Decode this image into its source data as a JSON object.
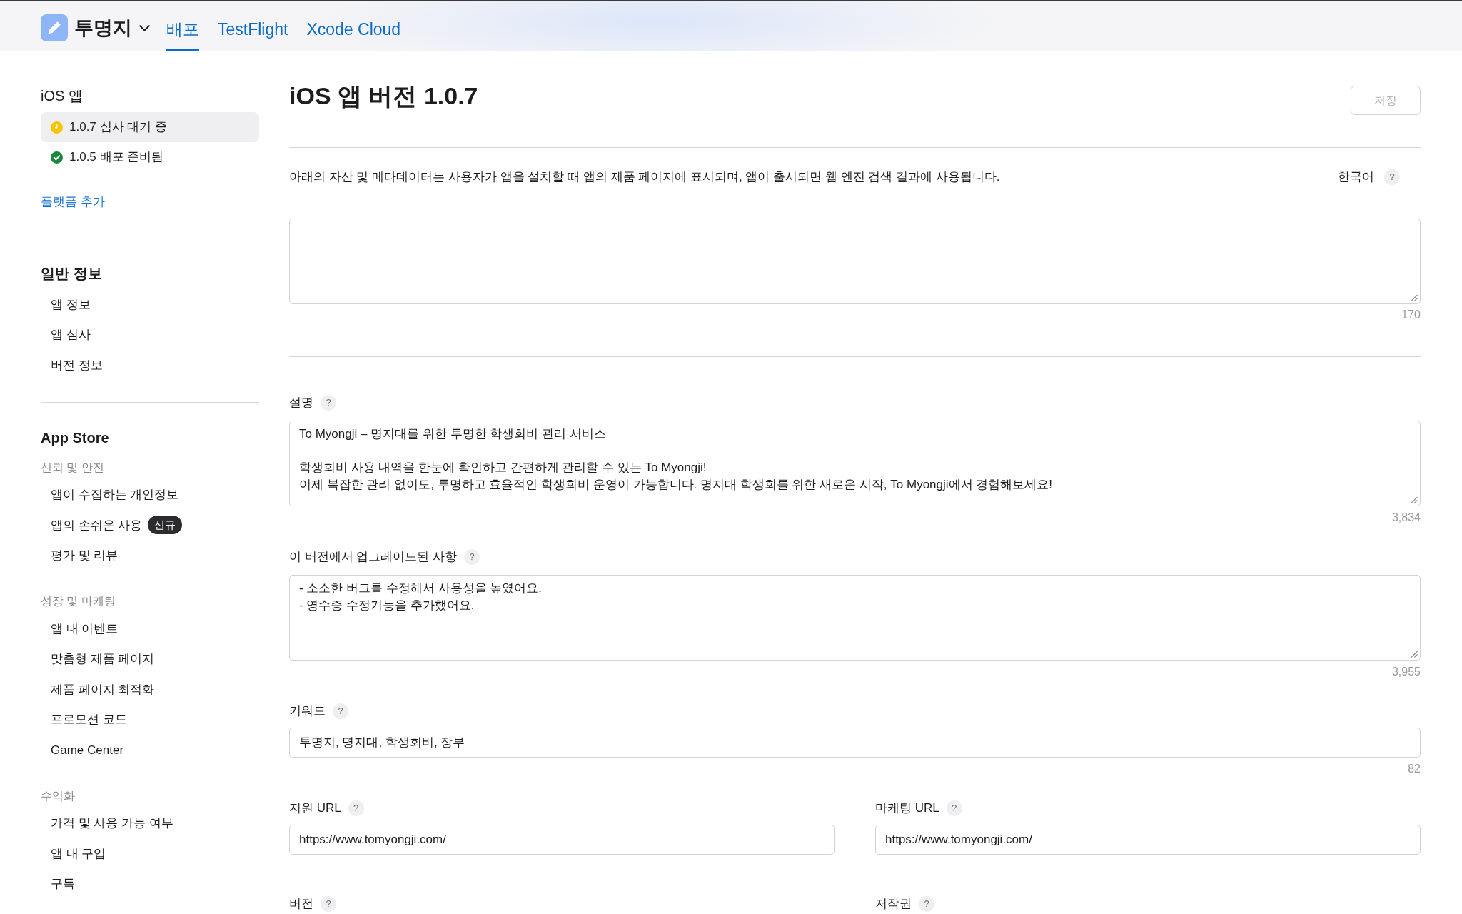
{
  "header": {
    "app_name": "투명지",
    "tabs": [
      {
        "label": "배포",
        "selected": true
      },
      {
        "label": "TestFlight",
        "selected": false
      },
      {
        "label": "Xcode Cloud",
        "selected": false
      }
    ]
  },
  "sidebar": {
    "platform_title": "iOS 앱",
    "versions": [
      {
        "label": "1.0.7 심사 대기 중",
        "kind": "waiting",
        "selected": true
      },
      {
        "label": "1.0.5 배포 준비됨",
        "kind": "ready",
        "selected": false
      }
    ],
    "add_platform": "플랫폼 추가",
    "sections": [
      {
        "title": "일반 정보",
        "groups": [
          {
            "items": [
              {
                "label": "앱 정보"
              },
              {
                "label": "앱 심사"
              },
              {
                "label": "버전 정보"
              }
            ]
          }
        ]
      },
      {
        "title": "App Store",
        "groups": [
          {
            "heading": "신뢰 및 안전",
            "items": [
              {
                "label": "앱이 수집하는 개인정보"
              },
              {
                "label": "앱의 손쉬운 사용",
                "badge": "신규"
              },
              {
                "label": "평가 및 리뷰"
              }
            ]
          },
          {
            "heading": "성장 및 마케팅",
            "items": [
              {
                "label": "앱 내 이벤트"
              },
              {
                "label": "맞춤형 제품 페이지"
              },
              {
                "label": "제품 페이지 최적화"
              },
              {
                "label": "프로모션 코드"
              },
              {
                "label": "Game Center"
              }
            ]
          },
          {
            "heading": "수익화",
            "items": [
              {
                "label": "가격 및 사용 가능 여부"
              },
              {
                "label": "앱 내 구입"
              },
              {
                "label": "구독"
              }
            ]
          }
        ]
      }
    ]
  },
  "main": {
    "title": "iOS 앱 버전 1.0.7",
    "save_button": {
      "label": "저장",
      "disabled": true
    },
    "intro": "아래의 자산 및 메타데이터는 사용자가 앱을 설치할 때 앱의 제품 페이지에 표시되며, 앱이 출시되면 웹 엔진 검색 결과에 사용됩니다.",
    "language": {
      "label": "한국어",
      "help": "?"
    },
    "promo_field": {
      "counter": "170"
    },
    "rows": [
      {
        "fields": [
          {
            "kind": "textarea",
            "label": "설명",
            "help": "?",
            "value": "To Myongji – 명지대를 위한 투명한 학생회비 관리 서비스\n\n학생회비 사용 내역을 한눈에 확인하고 간편하게 관리할 수 있는 To Myongji!\n이제 복잡한 관리 없이도, 투명하고 효율적인 학생회비 운영이 가능합니다. 명지대 학생회를 위한 새로운 시작, To Myongji에서 경험해보세요!",
            "counter": "3,834"
          }
        ]
      },
      {
        "fields": [
          {
            "kind": "textarea",
            "label": "이 버전에서 업그레이드된 사항",
            "help": "?",
            "value": "- 소소한 버그를 수정해서 사용성을 높였어요.\n- 영수증 수정기능을 추가했어요.",
            "counter": "3,955"
          }
        ]
      },
      {
        "fields": [
          {
            "kind": "text",
            "label": "키워드",
            "help": "?",
            "value": "투명지, 명지대, 학생회비, 장부",
            "counter": "82"
          }
        ]
      },
      {
        "fields": [
          {
            "kind": "text",
            "label": "지원 URL",
            "help": "?",
            "value": "https://www.tomyongji.com/"
          },
          {
            "kind": "text",
            "label": "마케팅 URL",
            "help": "?",
            "value": "https://www.tomyongji.com/"
          }
        ]
      },
      {
        "fields": [
          {
            "kind": "label",
            "label": "버전",
            "help": "?"
          },
          {
            "kind": "label",
            "label": "저작권",
            "help": "?"
          }
        ]
      }
    ]
  }
}
